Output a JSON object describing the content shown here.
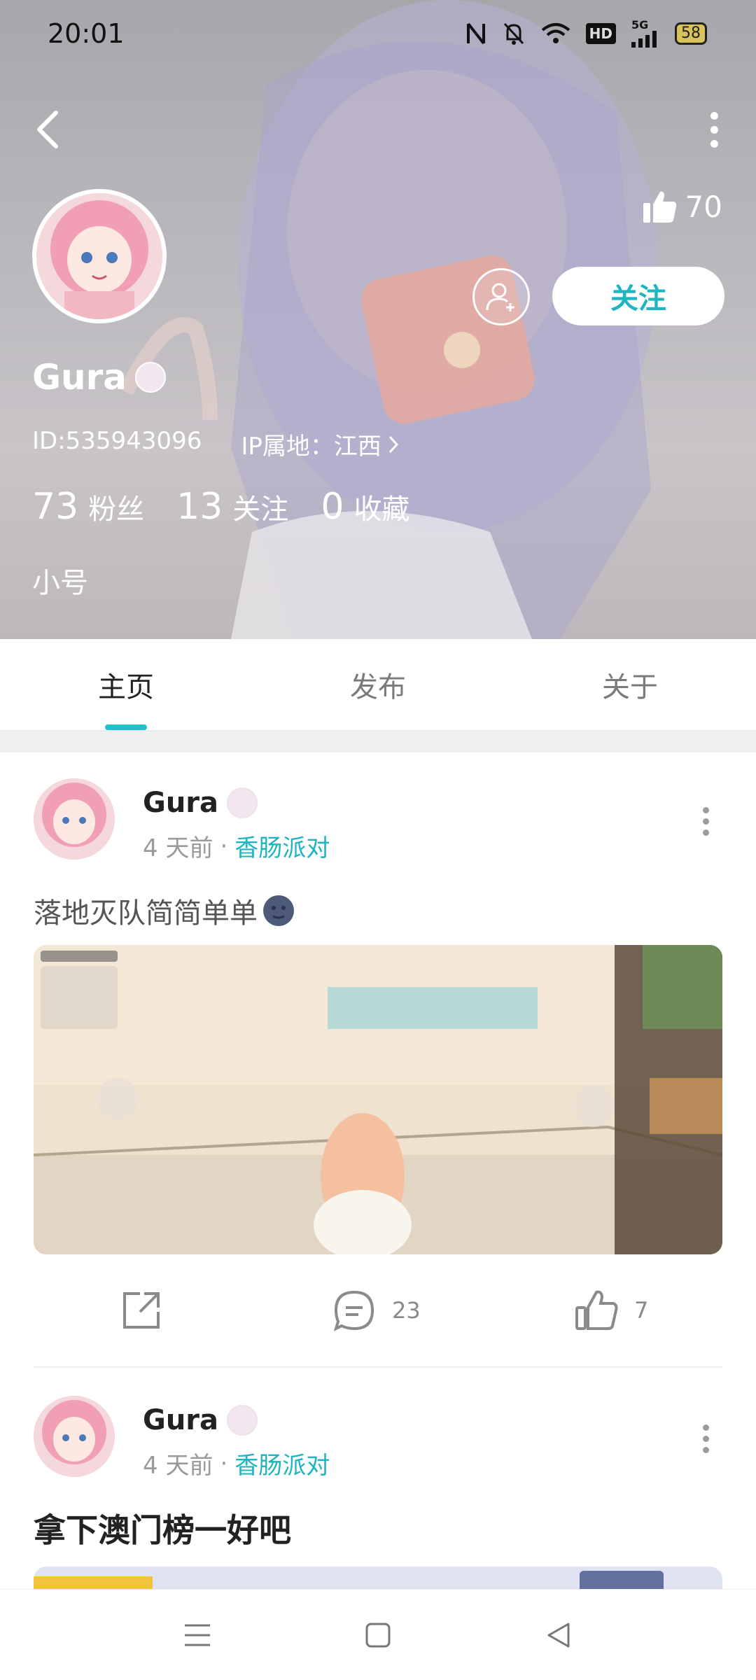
{
  "status_bar": {
    "time": "20:01",
    "network_label": "HD",
    "signal_label": "5G",
    "battery": "58",
    "icons": [
      "nfc-icon",
      "mute-bell-icon",
      "wifi-icon",
      "hd-icon",
      "signal-5g-icon",
      "battery-icon"
    ]
  },
  "profile": {
    "likes": "70",
    "name": "Gura",
    "id": "ID:535943096",
    "ip": "IP属地：江西",
    "stats": [
      {
        "num": "73",
        "label": "粉丝"
      },
      {
        "num": "13",
        "label": "关注"
      },
      {
        "num": "0",
        "label": "收藏"
      }
    ],
    "alt": "小号",
    "follow_label": "关注"
  },
  "tabs": [
    "主页",
    "发布",
    "关于"
  ],
  "posts": [
    {
      "name": "Gura",
      "time": "4 天前",
      "dot": "·",
      "topic": "香肠派对",
      "text": "落地灭队简简单单",
      "comments": "23",
      "likes": "7"
    },
    {
      "name": "Gura",
      "time": "4 天前",
      "dot": "·",
      "topic": "香肠派对",
      "text": "拿下澳门榜一好吧"
    }
  ],
  "colors": {
    "accent": "#1eb5c0",
    "header_bg": "#b3b1b5",
    "text_secondary": "#9a9a9a"
  }
}
